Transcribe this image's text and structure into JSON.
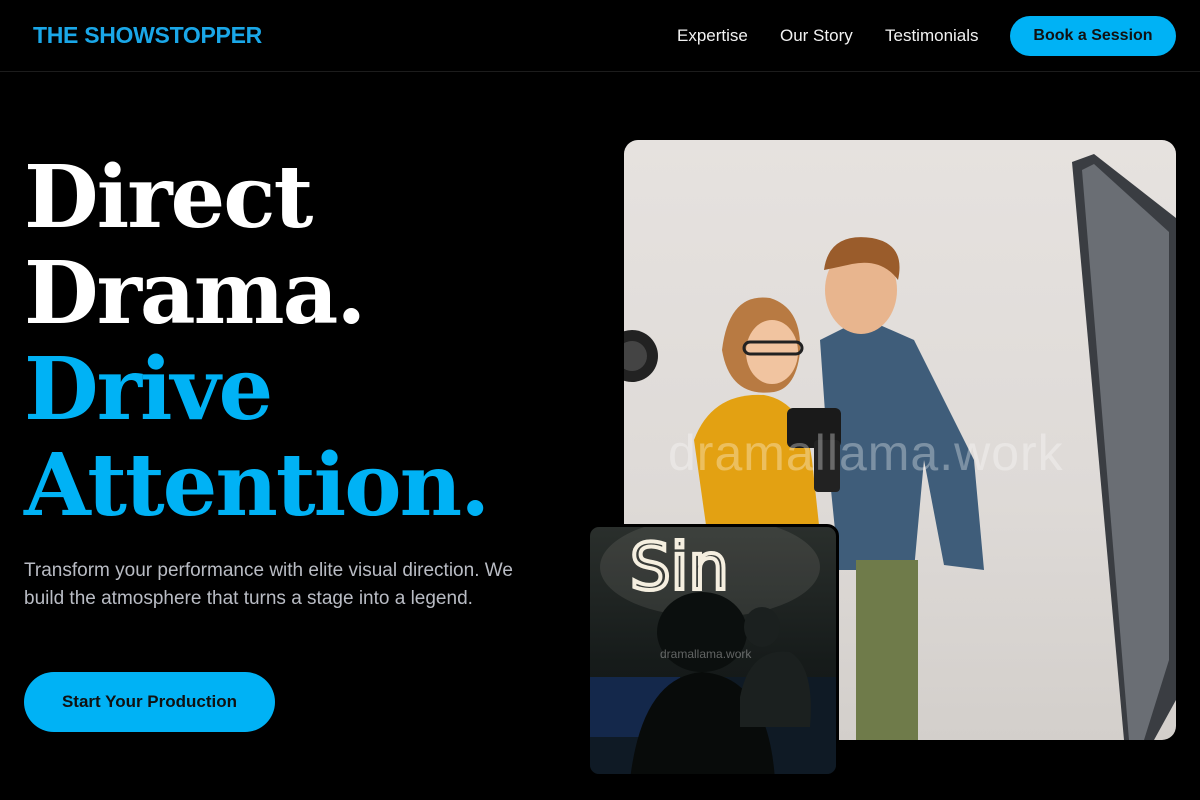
{
  "header": {
    "brand": "THE SHOWSTOPPER",
    "nav_links": [
      "Expertise",
      "Our Story",
      "Testimonials"
    ],
    "cta_label": "Book a Session"
  },
  "hero": {
    "headline_lines": [
      "Direct",
      "Drama.",
      "Drive",
      "Attention."
    ],
    "subtext": "Transform your performance with elite visual direction. We build the atmosphere that turns a stage into a legend.",
    "button_label": "Start Your Production"
  },
  "images": {
    "main_watermark": "dramallama.work",
    "small_sign_text": "Sin",
    "small_watermark": "dramallama.work"
  },
  "colors": {
    "accent": "#00b2f5",
    "background": "#000000",
    "brand": "#1aa7e8"
  }
}
